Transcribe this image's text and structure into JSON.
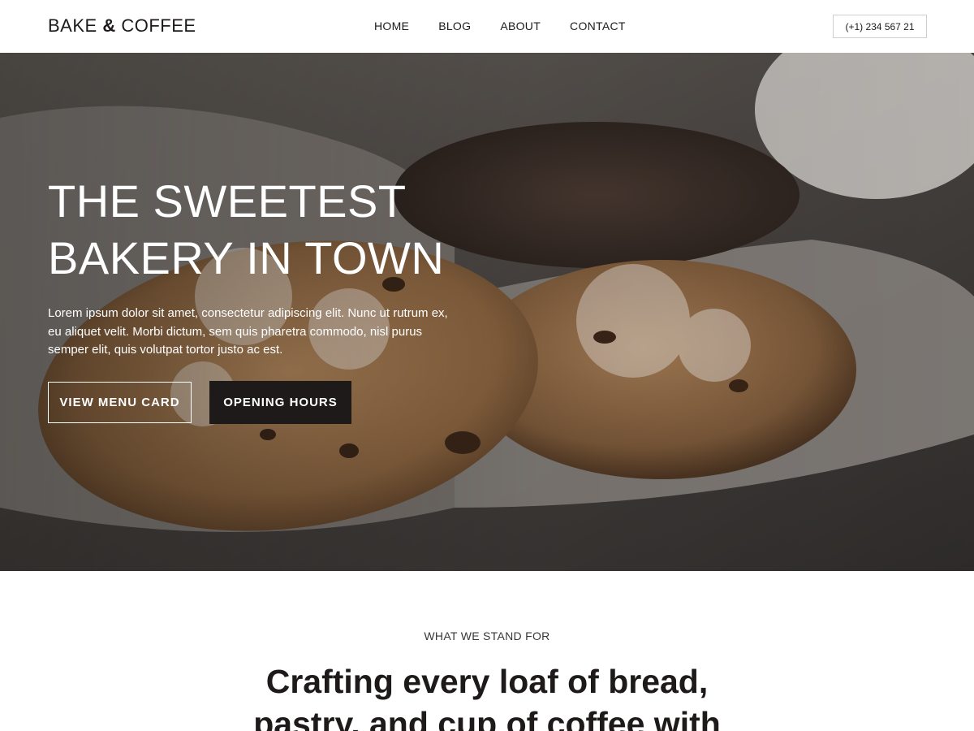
{
  "header": {
    "logo_left": "BAKE",
    "logo_amp": "&",
    "logo_right": "COFFEE",
    "nav": [
      "HOME",
      "BLOG",
      "ABOUT",
      "CONTACT"
    ],
    "phone": "(+1) 234 567 21"
  },
  "hero": {
    "title_line1": "THE SWEETEST",
    "title_line2": "BAKERY IN TOWN",
    "text": "Lorem ipsum dolor sit amet, consectetur adipiscing elit. Nunc ut rutrum ex, eu aliquet velit. Morbi dictum, sem quis pharetra commodo, nisl purus semper elit, quis volutpat tortor justo ac est.",
    "button_outline": "VIEW MENU CARD",
    "button_dark": "OPENING HOURS",
    "image": "cookies-photo"
  },
  "section": {
    "label": "WHAT WE STAND FOR",
    "heading": "Crafting every loaf of bread, pastry, and cup of coffee with"
  },
  "colors": {
    "text_dark": "#1e1a1a",
    "button_dark": "#1f1a1a",
    "white": "#ffffff"
  }
}
